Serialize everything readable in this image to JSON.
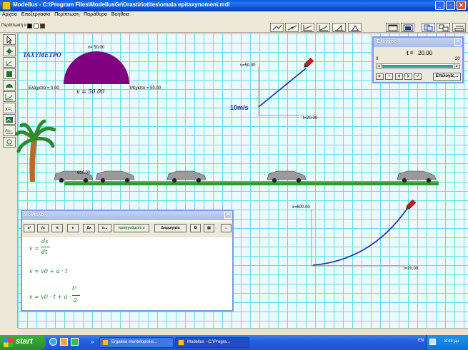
{
  "window": {
    "title": "Modellus - C:\\Program Files\\ModellusGr\\Drastiriotites\\omala epitaxynomeni.mdl",
    "minimize": "_",
    "maximize": "▫",
    "close": "✕"
  },
  "menu": [
    "Αρχείο",
    "Επεξεργασία",
    "Περίπτωση",
    "Παράθυρο",
    "Βοήθεια"
  ],
  "casebar": {
    "label": "Περίπτωση #"
  },
  "canvas": {
    "speedometer": {
      "title": "ΤΑΧΥΜΕΤΡΟ",
      "max_top": "v= 50.00",
      "min_label": "Ελάχιστο = 0.00",
      "max_label": "Μέγιστο = 50.00",
      "value_label": "v = 50.00",
      "color": "#800080"
    },
    "graph_v": {
      "ylabel": "v=50.00",
      "xlabel": "t=20.00",
      "annotation": "10m/s"
    },
    "graph_x": {
      "ylabel": "x=600.00",
      "xlabel": "t=20.00"
    },
    "road": {
      "label": "600.00"
    }
  },
  "model": {
    "title": "Μοντέλο",
    "buttons": [
      "x²",
      "√x",
      "π",
      "e",
      "Δx",
      "x₁..",
      "προηγούμενο x",
      "Διερμηνεία"
    ],
    "eq1": {
      "lhs": "v =",
      "num": "dx",
      "den": "dt"
    },
    "eq2": "v = v0 + a · t",
    "eq3": {
      "lhs": "x = v0 · t + a ·",
      "num": "t²",
      "den": "2"
    }
  },
  "control": {
    "title": "Έλεγχος",
    "time_label": "t =",
    "time_value": "20.00",
    "min": "0",
    "max": "20",
    "progress": 1.0,
    "options": "Επιλογές..."
  },
  "taskbar": {
    "start": "start",
    "tasks": [
      "Ergaleia montelopoiisi...",
      "Modellus - C:\\Progra..."
    ],
    "lang": "EN",
    "clock": "8:43 μμ"
  }
}
